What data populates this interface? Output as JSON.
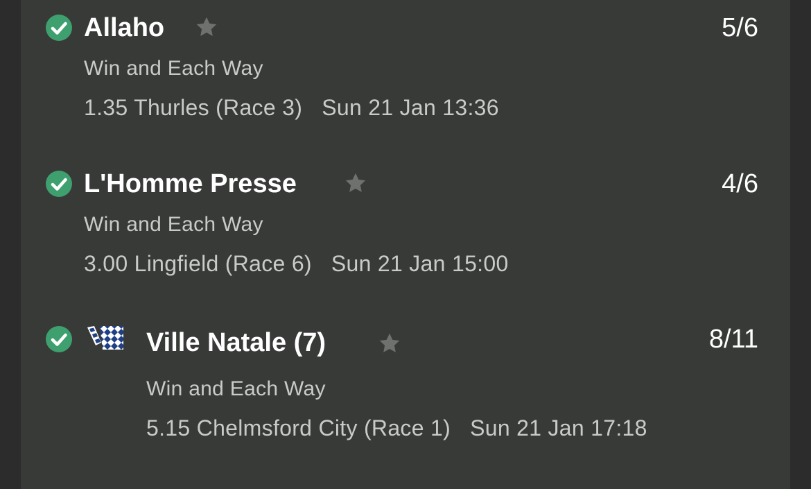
{
  "bets": [
    {
      "name": "Allaho",
      "odds": "5/6",
      "market": "Win and Each Way",
      "race": "1.35 Thurles (Race 3)",
      "datetime": "Sun 21 Jan 13:36",
      "status_icon": "check-circle-icon",
      "favourite_icon": "star-icon"
    },
    {
      "name": "L'Homme Presse",
      "odds": "4/6",
      "market": "Win and Each Way",
      "race": "3.00 Lingfield (Race 6)",
      "datetime": "Sun 21 Jan 15:00",
      "status_icon": "check-circle-icon",
      "favourite_icon": "star-icon"
    },
    {
      "name": "Ville Natale (7)",
      "odds": "8/11",
      "market": "Win and Each Way",
      "race": "5.15 Chelmsford City (Race 1)",
      "datetime": "Sun 21 Jan 17:18",
      "status_icon": "check-circle-icon",
      "favourite_icon": "star-icon",
      "silks_icon": "jockey-silks-icon"
    }
  ],
  "colors": {
    "background": "#2b2c2b",
    "panel": "#383a38",
    "check": "#3fa06f",
    "star": "#6f716f",
    "primary_text": "#ffffff",
    "secondary_text": "#c9cbc9"
  }
}
